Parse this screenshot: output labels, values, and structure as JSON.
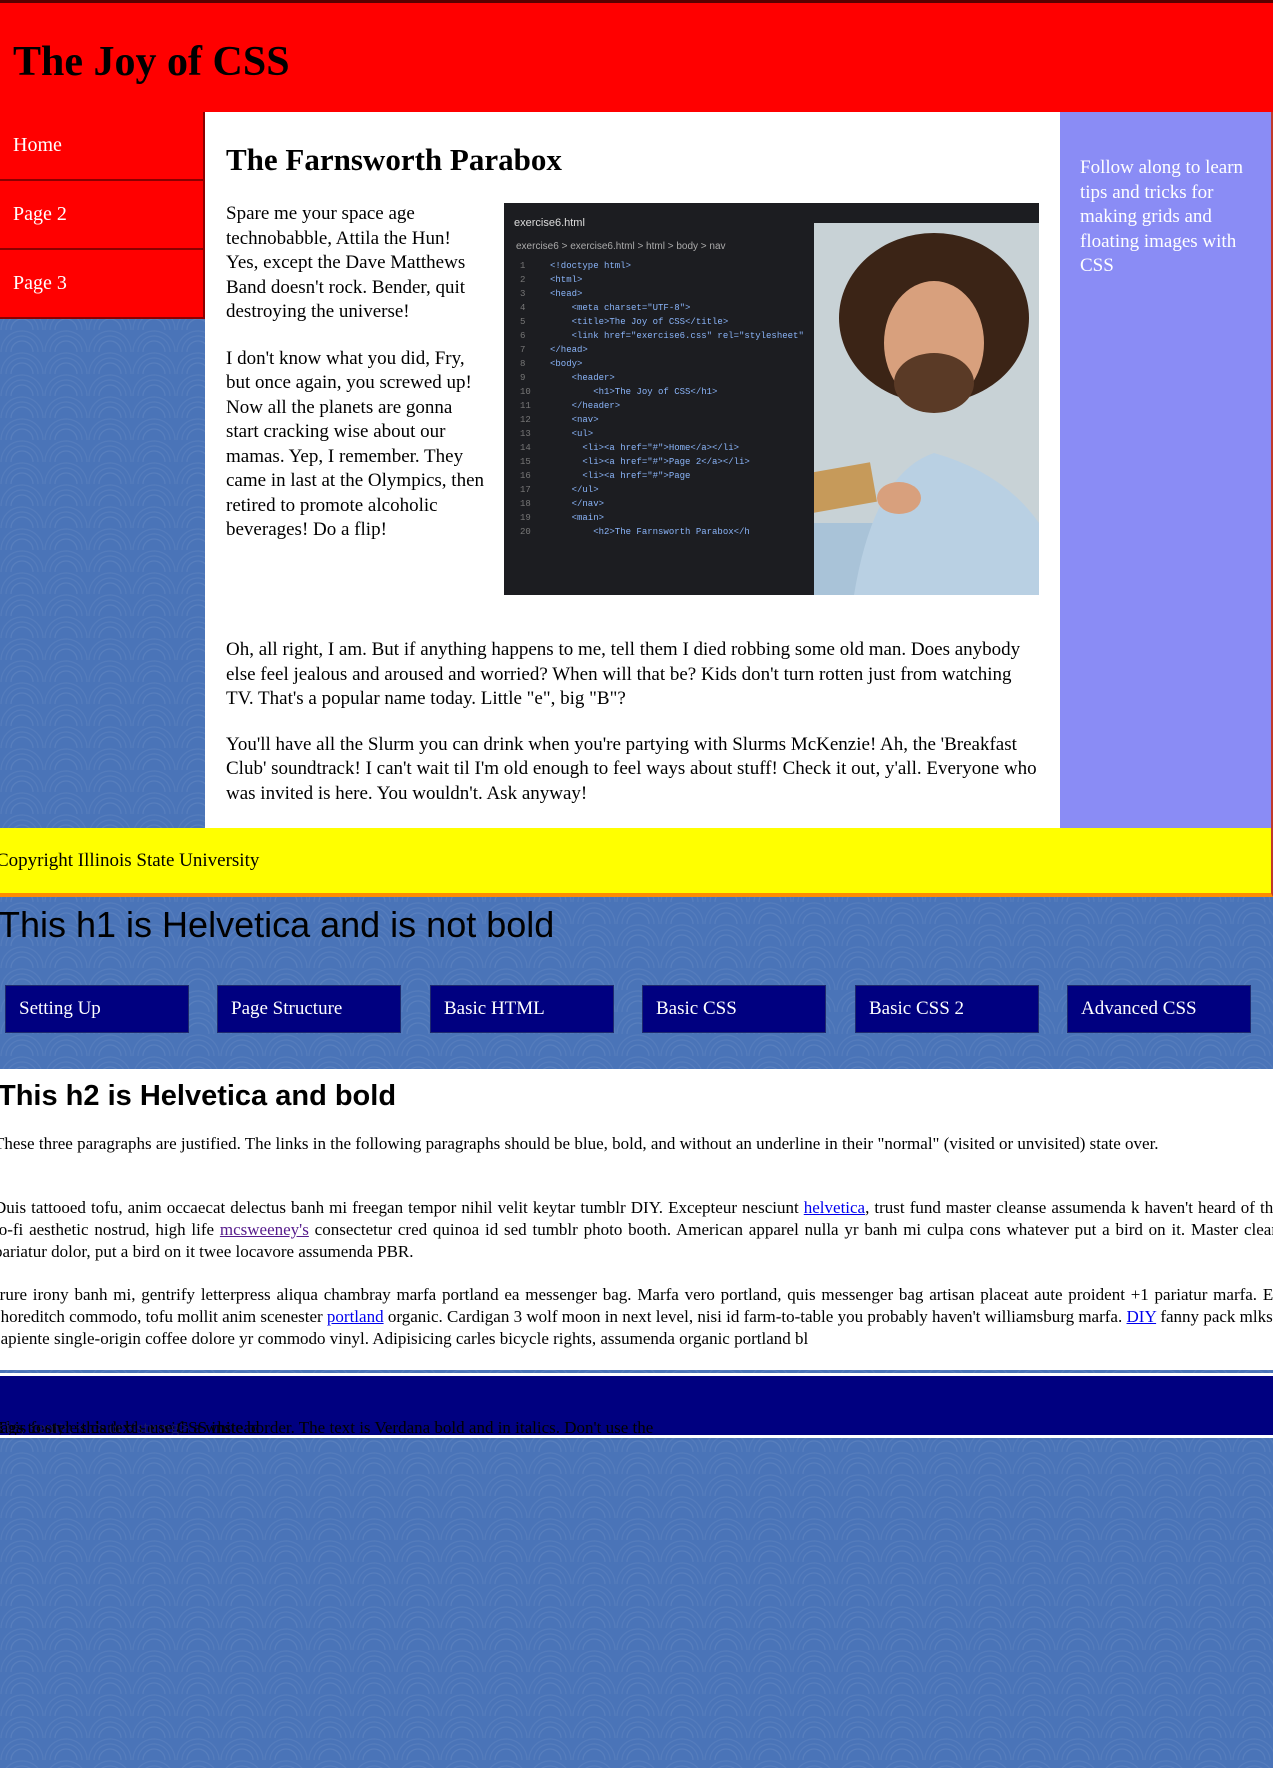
{
  "header": {
    "title": "The Joy of CSS"
  },
  "nav": {
    "items": [
      "Home",
      "Page 2",
      "Page 3"
    ]
  },
  "main": {
    "title": "The Farnsworth Parabox",
    "paragraphs_left": [
      "Spare me your space age technobabble, Attila the Hun! Yes, except the Dave Matthews Band doesn't rock. Bender, quit destroying the universe!",
      "I don't know what you did, Fry, but once again, you screwed up! Now all the planets are gonna start cracking wise about our mamas. Yep, I remember. They came in last at the Olympics, then retired to promote alcoholic beverages! Do a flip!"
    ],
    "paragraphs_wide": [
      "Oh, all right, I am. But if anything happens to me, tell them I died robbing some old man. Does anybody else feel jealous and aroused and worried? When will that be? Kids don't turn rotten just from watching TV. That's a popular name today. Little \"e\", big \"B\"?",
      "You'll have all the Slurm you can drink when you're partying with Slurms McKenzie! Ah, the 'Breakfast Club' soundtrack! I can't wait til I'm old enough to feel ways about stuff! Check it out, y'all. Everyone who was invited is here. You wouldn't. Ask anyway!"
    ],
    "photo": {
      "tab": "exercise6.html",
      "crumbs": "exercise6 > exercise6.html > html > body > nav",
      "code_lines": [
        {
          "n": "1",
          "t": "<!doctype html>"
        },
        {
          "n": "2",
          "t": "<html>"
        },
        {
          "n": "3",
          "t": "<head>"
        },
        {
          "n": "4",
          "t": "    <meta charset=\"UTF-8\">"
        },
        {
          "n": "5",
          "t": "    <title>The Joy of CSS</title>"
        },
        {
          "n": "6",
          "t": "    <link href=\"exercise6.css\" rel=\"stylesheet\""
        },
        {
          "n": "7",
          "t": "</head>"
        },
        {
          "n": "8",
          "t": "<body>"
        },
        {
          "n": "9",
          "t": "    <header>"
        },
        {
          "n": "10",
          "t": "        <h1>The Joy of CSS</h1>"
        },
        {
          "n": "11",
          "t": "    </header>"
        },
        {
          "n": "12",
          "t": "    <nav>"
        },
        {
          "n": "13",
          "t": "    <ul>"
        },
        {
          "n": "14",
          "t": "      <li><a href=\"#\">Home</a></li>"
        },
        {
          "n": "15",
          "t": "      <li><a href=\"#\">Page 2</a></li>"
        },
        {
          "n": "16",
          "t": "      <li><a href=\"#\">Page"
        },
        {
          "n": "17",
          "t": "    </ul>"
        },
        {
          "n": "18",
          "t": "    </nav>"
        },
        {
          "n": "19",
          "t": "    <main>"
        },
        {
          "n": "20",
          "t": "        <h2>The Farnsworth Parabox</h"
        }
      ]
    }
  },
  "aside": {
    "text": "Follow along to learn tips and tricks for making grids and floating images with CSS"
  },
  "footer_top": {
    "text": "Copyright Illinois State University"
  },
  "lower": {
    "h1": "This h1 is Helvetica and is not bold",
    "tabs": [
      "Setting Up",
      "Page Structure",
      "Basic HTML",
      "Basic CSS",
      "Basic CSS 2",
      "Advanced CSS"
    ],
    "h2": "This h2 is Helvetica and bold",
    "p1": "These three paragraphs are justified. The links in the following paragraphs should be blue, bold, and without an underline in their \"normal\" (visited or unvisited) state over.",
    "p2": {
      "a": "Duis tattooed tofu, anim occaecat delectus banh mi freegan tempor nihil velit keytar tumblr DIY. Excepteur nesciunt ",
      "link1": "helvetica",
      "b": ", trust fund master cleanse assumenda k haven't heard of them lo-fi aesthetic nostrud, high life ",
      "link2": "mcsweeney's",
      "c": " consectetur cred quinoa id sed tumblr photo booth. American apparel nulla yr banh mi culpa cons whatever put a bird on it. Master cleanse pariatur dolor, put a bird on it twee locavore assumenda PBR."
    },
    "p3": {
      "a": "Irure irony banh mi, gentrify letterpress aliqua chambray marfa portland ea messenger bag. Marfa vero portland, quis messenger bag artisan placeat aute proident +1 pariatur marfa. Esse shoreditch commodo, tofu mollit anim scenester ",
      "link1": "portland",
      "b": " organic. Cardigan 3 wolf moon in next level, nisi id farm-to-table you probably haven't williamsburg marfa. ",
      "link2": "DIY",
      "c": " fanny pack mlkshk, sapiente single-origin coffee dolore yr commodo vinyl. Adipisicing carles bicycle rights, assumenda organic portland bl"
    },
    "footer": {
      "a": "This footer is dark blue with a white border. The text is Verdana bold and in italics. Don't use the ",
      "code": "<i>, <em>, <b> or <strong>",
      "b": " tags to style this text - use CSS instead"
    }
  },
  "colors": {
    "header_red": "#ff0000",
    "aside_purple": "#8a8cf5",
    "footer_yellow": "#ffff00",
    "tab_navy": "#000080",
    "pattern_blue": "#4a74b8"
  }
}
